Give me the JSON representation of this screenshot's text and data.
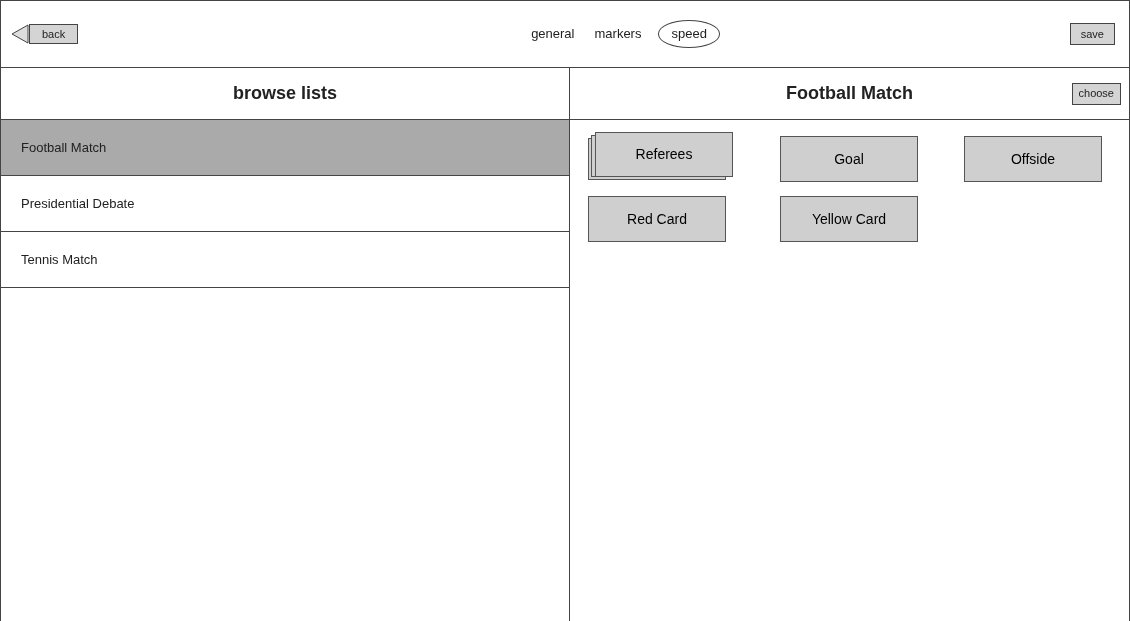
{
  "toolbar": {
    "back": "back",
    "tabs": [
      {
        "label": "general",
        "selected": false
      },
      {
        "label": "markers",
        "selected": false
      },
      {
        "label": "speed",
        "selected": true
      }
    ],
    "save": "save"
  },
  "browse": {
    "title": "browse lists",
    "items": [
      {
        "label": "Football Match",
        "selected": true
      },
      {
        "label": "Presidential Debate",
        "selected": false
      },
      {
        "label": "Tennis Match",
        "selected": false
      }
    ]
  },
  "detail": {
    "title": "Football Match",
    "choose": "choose",
    "markers": [
      {
        "label": "Referees",
        "kind": "stack"
      },
      {
        "label": "Goal",
        "kind": "button"
      },
      {
        "label": "Offside",
        "kind": "button"
      },
      {
        "label": "Red Card",
        "kind": "button"
      },
      {
        "label": "Yellow Card",
        "kind": "button"
      }
    ]
  }
}
